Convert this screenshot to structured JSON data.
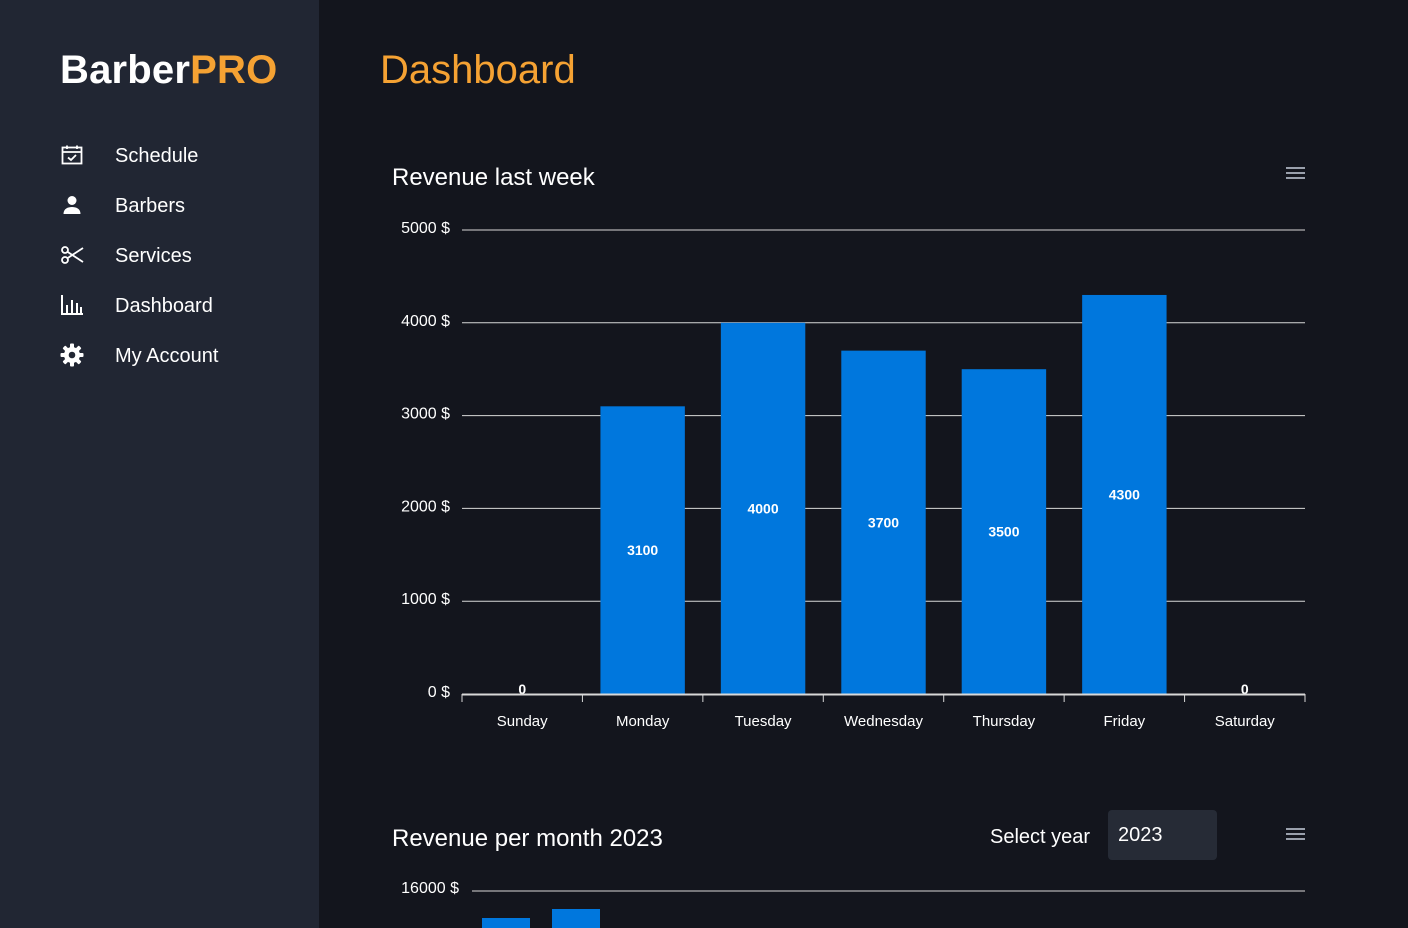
{
  "brand": {
    "part1": "Barber",
    "part2": "PRO"
  },
  "sidebar": {
    "items": [
      {
        "label": "Schedule",
        "icon": "calendar-check-icon"
      },
      {
        "label": "Barbers",
        "icon": "person-icon"
      },
      {
        "label": "Services",
        "icon": "scissors-icon"
      },
      {
        "label": "Dashboard",
        "icon": "bar-chart-icon"
      },
      {
        "label": "My Account",
        "icon": "gear-icon"
      }
    ]
  },
  "page": {
    "title": "Dashboard"
  },
  "colors": {
    "accent": "#f5a233",
    "bar": "#0077dd",
    "sidebar": "#212633",
    "background": "#13151d"
  },
  "weekly": {
    "title": "Revenue last week",
    "chart_data": {
      "type": "bar",
      "categories": [
        "Sunday",
        "Monday",
        "Tuesday",
        "Wednesday",
        "Thursday",
        "Friday",
        "Saturday"
      ],
      "values": [
        0,
        3100,
        4000,
        3700,
        3500,
        4300,
        0
      ],
      "ylim": [
        0,
        5000
      ],
      "yticks": [
        "0 $",
        "1000 $",
        "2000 $",
        "3000 $",
        "4000 $",
        "5000 $"
      ],
      "grid": true
    }
  },
  "monthly": {
    "title": "Revenue per month 2023",
    "select_label": "Select year",
    "selected_year": "2023",
    "chart_data": {
      "type": "bar",
      "ytick_top": "16000 $"
    }
  }
}
